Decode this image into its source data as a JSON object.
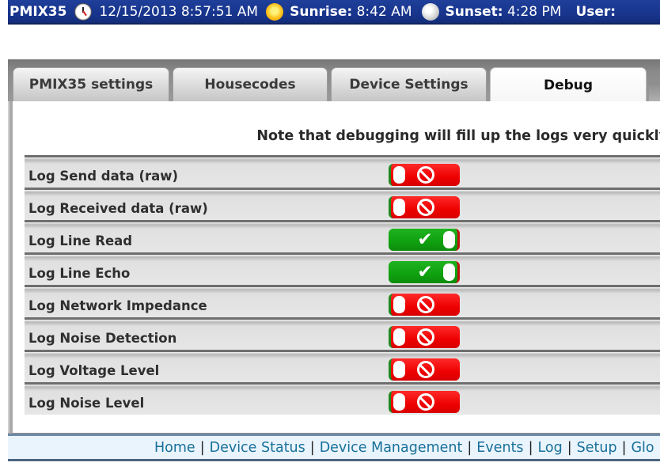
{
  "header": {
    "brand": "PMIX35",
    "datetime": "12/15/2013 8:57:51 AM",
    "sunrise_label": "Sunrise:",
    "sunrise_value": "8:42 AM",
    "sunset_label": "Sunset:",
    "sunset_value": "4:28 PM",
    "user_label": "User:",
    "icons": {
      "clock": "clock-icon",
      "sunrise": "sun-icon",
      "sunset": "moon-icon"
    }
  },
  "tabs": [
    {
      "label": "PMIX35 settings",
      "active": false
    },
    {
      "label": "Housecodes",
      "active": false
    },
    {
      "label": "Device Settings",
      "active": false
    },
    {
      "label": "Debug",
      "active": true
    }
  ],
  "debug": {
    "note": "Note that debugging will fill up the logs very quickly",
    "settings": [
      {
        "label": "Log Send data (raw)",
        "enabled": false
      },
      {
        "label": "Log Received data (raw)",
        "enabled": false
      },
      {
        "label": "Log Line Read",
        "enabled": true
      },
      {
        "label": "Log Line Echo",
        "enabled": true
      },
      {
        "label": "Log Network Impedance",
        "enabled": false
      },
      {
        "label": "Log Noise Detection",
        "enabled": false
      },
      {
        "label": "Log Voltage Level",
        "enabled": false
      },
      {
        "label": "Log Noise Level",
        "enabled": false
      }
    ],
    "on_symbol": "✔",
    "colors": {
      "on": "#12a612",
      "off": "#ee0000"
    }
  },
  "footer": {
    "links": [
      "Home",
      "Device Status",
      "Device Management",
      "Events",
      "Log",
      "Setup",
      "Glo"
    ],
    "separator": "|"
  }
}
